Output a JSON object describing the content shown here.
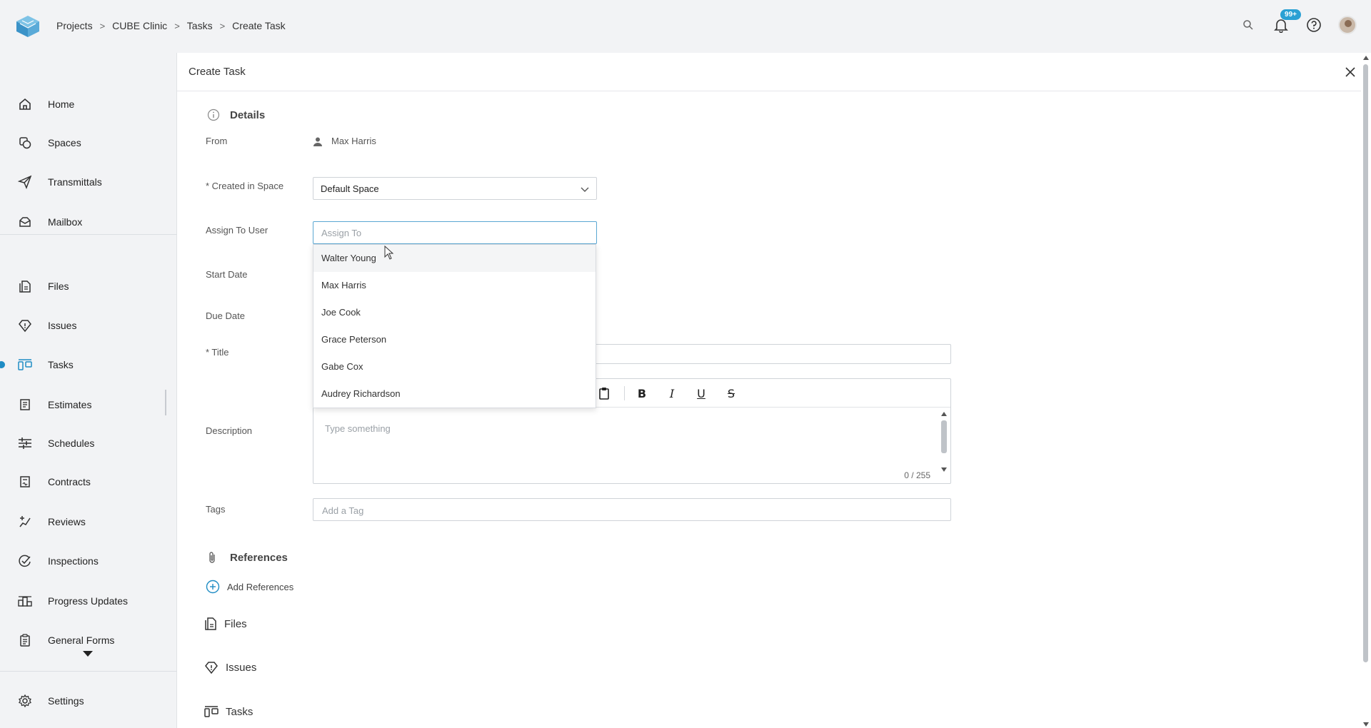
{
  "breadcrumb": [
    "Projects",
    "CUBE Clinic",
    "Tasks",
    "Create Task"
  ],
  "header": {
    "notifications_badge": "99+"
  },
  "sidebar": {
    "items": [
      {
        "label": "Home",
        "icon": "home-icon"
      },
      {
        "label": "Spaces",
        "icon": "spaces-icon"
      },
      {
        "label": "Transmittals",
        "icon": "send-icon"
      },
      {
        "label": "Mailbox",
        "icon": "mailbox-icon"
      },
      {
        "label": "Files",
        "icon": "files-icon"
      },
      {
        "label": "Issues",
        "icon": "issues-icon"
      },
      {
        "label": "Tasks",
        "icon": "tasks-icon",
        "active": true
      },
      {
        "label": "Estimates",
        "icon": "estimates-icon"
      },
      {
        "label": "Schedules",
        "icon": "schedules-icon"
      },
      {
        "label": "Contracts",
        "icon": "contracts-icon"
      },
      {
        "label": "Reviews",
        "icon": "reviews-icon"
      },
      {
        "label": "Inspections",
        "icon": "inspections-icon"
      },
      {
        "label": "Progress Updates",
        "icon": "progress-icon"
      },
      {
        "label": "General Forms",
        "icon": "forms-icon"
      }
    ],
    "settings_label": "Settings"
  },
  "panel": {
    "title": "Create Task",
    "details_title": "Details",
    "from_label": "From",
    "from_value": "Max Harris",
    "created_in_space_label": "* Created in Space",
    "created_in_space_value": "Default Space",
    "assign_label": "Assign To User",
    "assign_placeholder": "Assign To",
    "start_date_label": "Start Date",
    "due_date_label": "Due Date",
    "title_label": "* Title",
    "description_label": "Description",
    "description_placeholder": "Type something",
    "description_counter": "0 / 255",
    "tags_label": "Tags",
    "tags_placeholder": "Add a Tag",
    "references_title": "References",
    "add_references_label": "Add References",
    "ref_sections": [
      "Files",
      "Issues",
      "Tasks"
    ]
  },
  "dropdown": {
    "options": [
      "Walter Young",
      "Max Harris",
      "Joe Cook",
      "Grace Peterson",
      "Gabe Cox",
      "Audrey Richardson"
    ],
    "hovered": "Walter Young"
  },
  "colors": {
    "accent": "#1e8cc4",
    "badge": "#2aa0d4",
    "input_focus": "#5aa7d3"
  }
}
